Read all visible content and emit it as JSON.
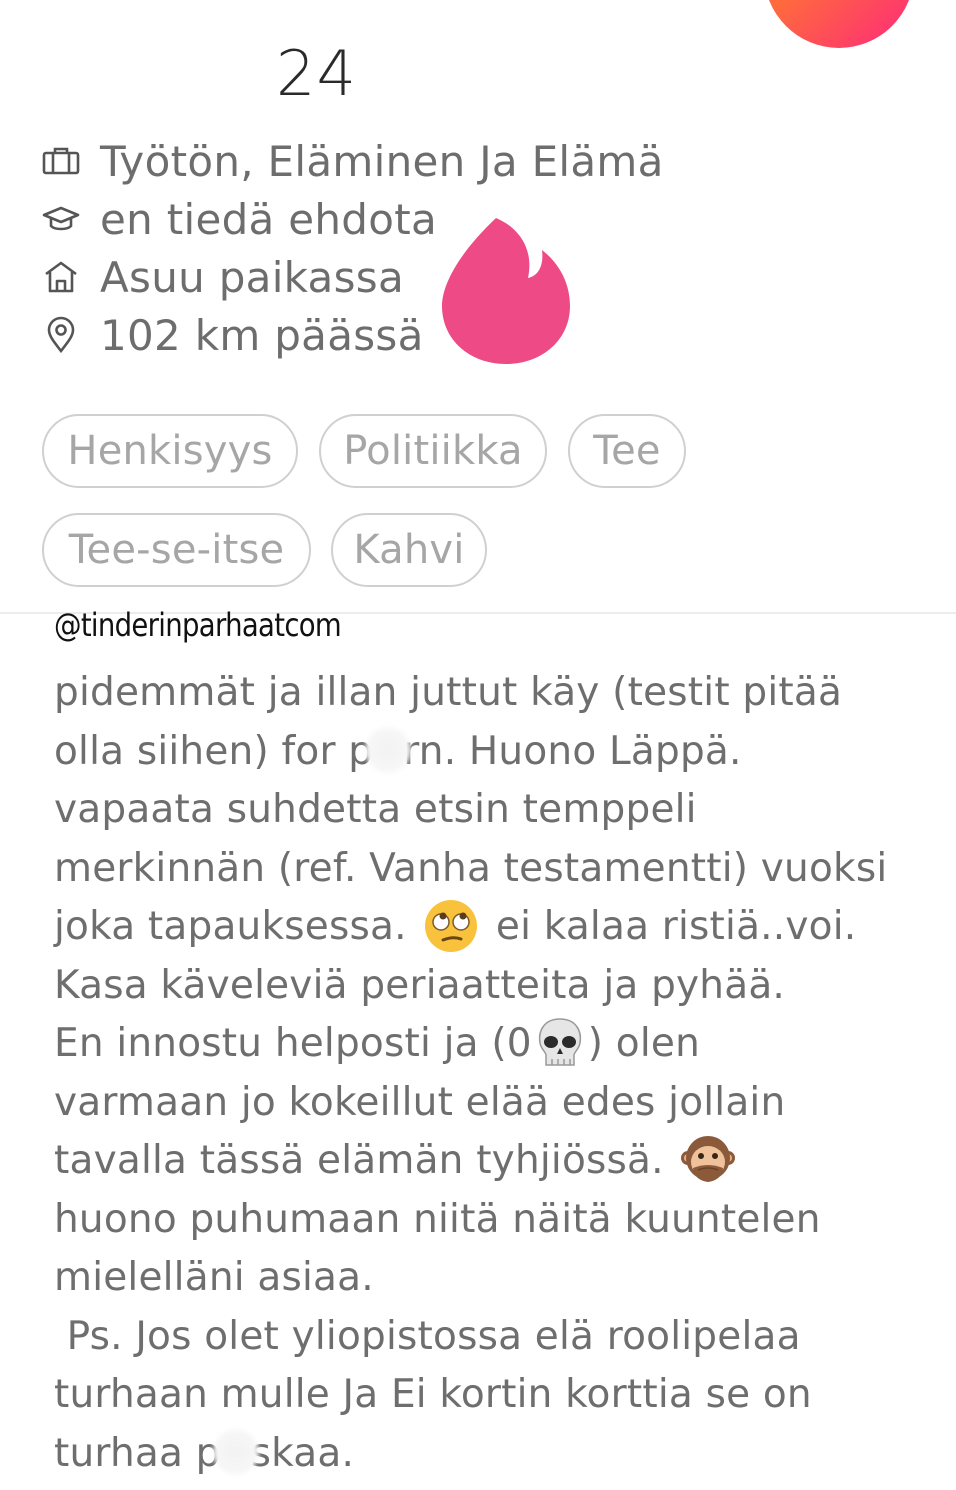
{
  "profile": {
    "age": "24",
    "job": "Työtön, Eläminen Ja Elämä",
    "school": "en tiedä ehdota",
    "living": "Asuu paikassa",
    "distance": "102 km päässä"
  },
  "icons": {
    "job": "briefcase-icon",
    "school": "graduation-cap-icon",
    "home": "home-icon",
    "distance": "location-pin-icon",
    "overlay": "tinder-flame-logo"
  },
  "colors": {
    "flame": "#ee4b86",
    "fab_gradient": [
      "#fd5564",
      "#fd297b"
    ],
    "chip_border": "#d0d0d0",
    "chip_text": "#a6a6a6",
    "text": "#6e6e6e"
  },
  "interests": [
    "Henkisyys",
    "Politiikka",
    "Tee",
    "Tee-se-itse",
    "Kahvi"
  ],
  "watermark": "@tinderinparhaatcom",
  "bio": {
    "l1": "pidemmät ja illan juttut käy (testit pitää",
    "l2a": "olla siihen) for p",
    "l2b": "rn. Huono Läppä.",
    "l3": "vapaata suhdetta etsin temppeli",
    "l4": "merkinnän (ref. Vanha testamentti) vuoksi",
    "l5a": "joka tapauksessa.",
    "l5b": "ei kalaa ristiä..voi.",
    "l6": "Kasa käveleviä periaatteita ja pyhää.",
    "l7a": "En innostu helposti ja (0",
    "l7b": ") olen",
    "l8": "varmaan jo kokeillut elää edes jollain",
    "l9a": "tavalla tässä elämän tyhjiössä.",
    "l10": "huono puhumaan niitä näitä kuuntelen",
    "l11": "mielelläni asiaa.",
    "l12": " Ps. Jos olet yliopistossa elä roolipelaa",
    "l13": "turhaan mulle Ja Ei kortin korttia se on",
    "l14a": "turhaa p",
    "l14b": "skaa."
  },
  "emojis": [
    "eye-roll-emoji",
    "skull-emoji",
    "speak-no-evil-monkey-emoji"
  ]
}
